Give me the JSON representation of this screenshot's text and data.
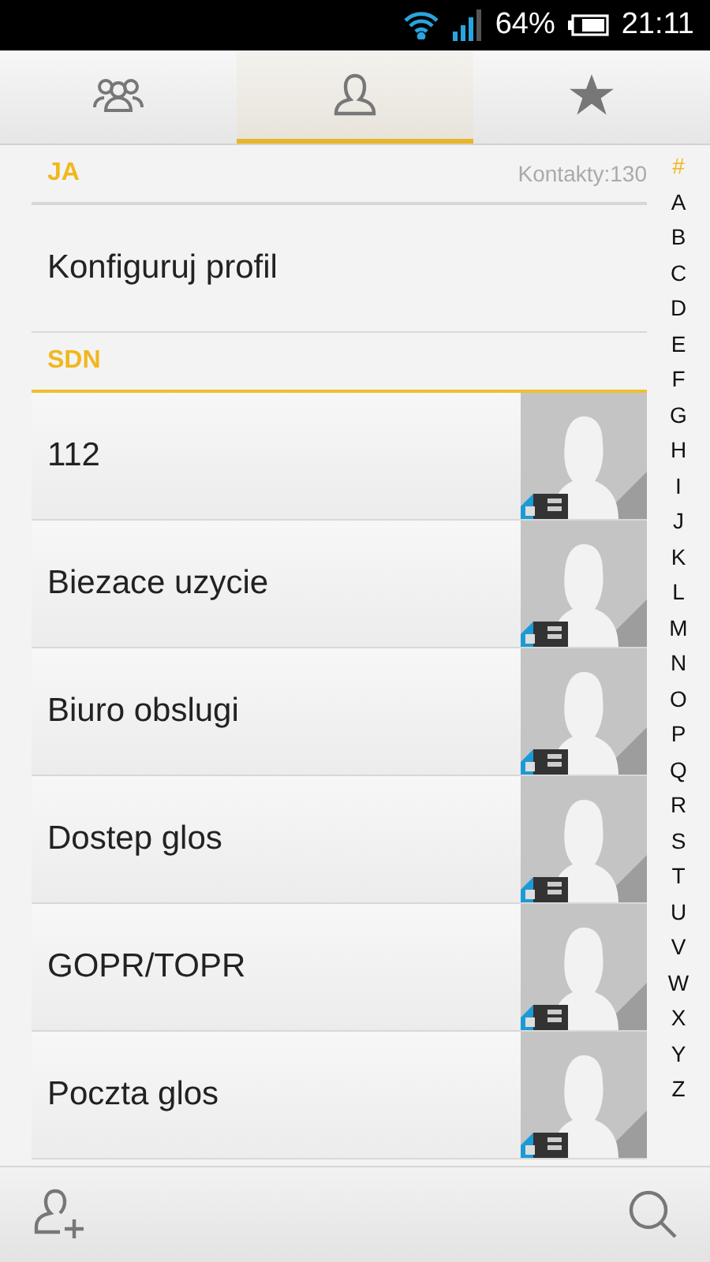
{
  "status_bar": {
    "battery": "64%",
    "time": "21:11"
  },
  "tabs": [
    {
      "kind": "groups",
      "selected": false
    },
    {
      "kind": "person",
      "selected": true
    },
    {
      "kind": "star",
      "selected": false
    }
  ],
  "sections": [
    {
      "title": "JA",
      "count": "Kontakty:130",
      "rows": [
        {
          "kind": "plain",
          "name": "Konfiguruj profil"
        }
      ]
    },
    {
      "title": "SDN",
      "rows": [
        {
          "kind": "sim",
          "name": "112"
        },
        {
          "kind": "sim",
          "name": "Biezace uzycie"
        },
        {
          "kind": "sim",
          "name": "Biuro obslugi"
        },
        {
          "kind": "sim",
          "name": "Dostep glos"
        },
        {
          "kind": "sim",
          "name": "GOPR/TOPR"
        },
        {
          "kind": "sim",
          "name": "Poczta glos"
        }
      ]
    }
  ],
  "index": [
    {
      "label": "#",
      "selected": true
    },
    {
      "label": "A",
      "selected": false
    },
    {
      "label": "B",
      "selected": false
    },
    {
      "label": "C",
      "selected": false
    },
    {
      "label": "D",
      "selected": false
    },
    {
      "label": "E",
      "selected": false
    },
    {
      "label": "F",
      "selected": false
    },
    {
      "label": "G",
      "selected": false
    },
    {
      "label": "H",
      "selected": false
    },
    {
      "label": "I",
      "selected": false
    },
    {
      "label": "J",
      "selected": false
    },
    {
      "label": "K",
      "selected": false
    },
    {
      "label": "L",
      "selected": false
    },
    {
      "label": "M",
      "selected": false
    },
    {
      "label": "N",
      "selected": false
    },
    {
      "label": "O",
      "selected": false
    },
    {
      "label": "P",
      "selected": false
    },
    {
      "label": "Q",
      "selected": false
    },
    {
      "label": "R",
      "selected": false
    },
    {
      "label": "S",
      "selected": false
    },
    {
      "label": "T",
      "selected": false
    },
    {
      "label": "U",
      "selected": false
    },
    {
      "label": "V",
      "selected": false
    },
    {
      "label": "W",
      "selected": false
    },
    {
      "label": "X",
      "selected": false
    },
    {
      "label": "Y",
      "selected": false
    },
    {
      "label": "Z",
      "selected": false
    }
  ]
}
